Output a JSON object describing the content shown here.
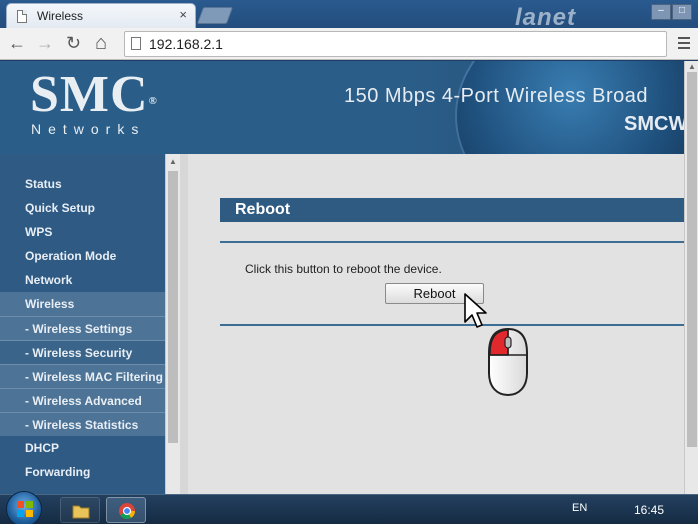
{
  "browser": {
    "tab_title": "Wireless",
    "tab_close": "×",
    "brand_watermark": "lanet",
    "url": "192.168.2.1",
    "nav": {
      "back": "←",
      "forward": "→",
      "reload": "↻",
      "home": "⌂"
    }
  },
  "header": {
    "logo": "SMC",
    "logo_mark": "®",
    "logo_sub": "Networks",
    "product_title": "150 Mbps 4-Port Wireless Broad",
    "model": "SMCW"
  },
  "sidebar": {
    "items": [
      {
        "label": "Status"
      },
      {
        "label": "Quick Setup"
      },
      {
        "label": "WPS"
      },
      {
        "label": "Operation Mode"
      },
      {
        "label": "Network"
      },
      {
        "label": "Wireless"
      },
      {
        "label": "- Wireless Settings"
      },
      {
        "label": "- Wireless Security"
      },
      {
        "label": "- Wireless MAC Filtering"
      },
      {
        "label": "- Wireless Advanced"
      },
      {
        "label": "- Wireless Statistics"
      },
      {
        "label": "DHCP"
      },
      {
        "label": "Forwarding"
      }
    ]
  },
  "main": {
    "section_title": "Reboot",
    "description": "Click this button to reboot the device.",
    "reboot_button": "Reboot"
  },
  "taskbar": {
    "language": "EN",
    "time": "16:45"
  },
  "colors": {
    "header_blue": "#2a5d88",
    "sidebar_blue": "#2e5a84",
    "sidebar_sub": "#4d7497",
    "section_title_bg": "#2f5b83",
    "content_bg": "#e2e2e2"
  }
}
